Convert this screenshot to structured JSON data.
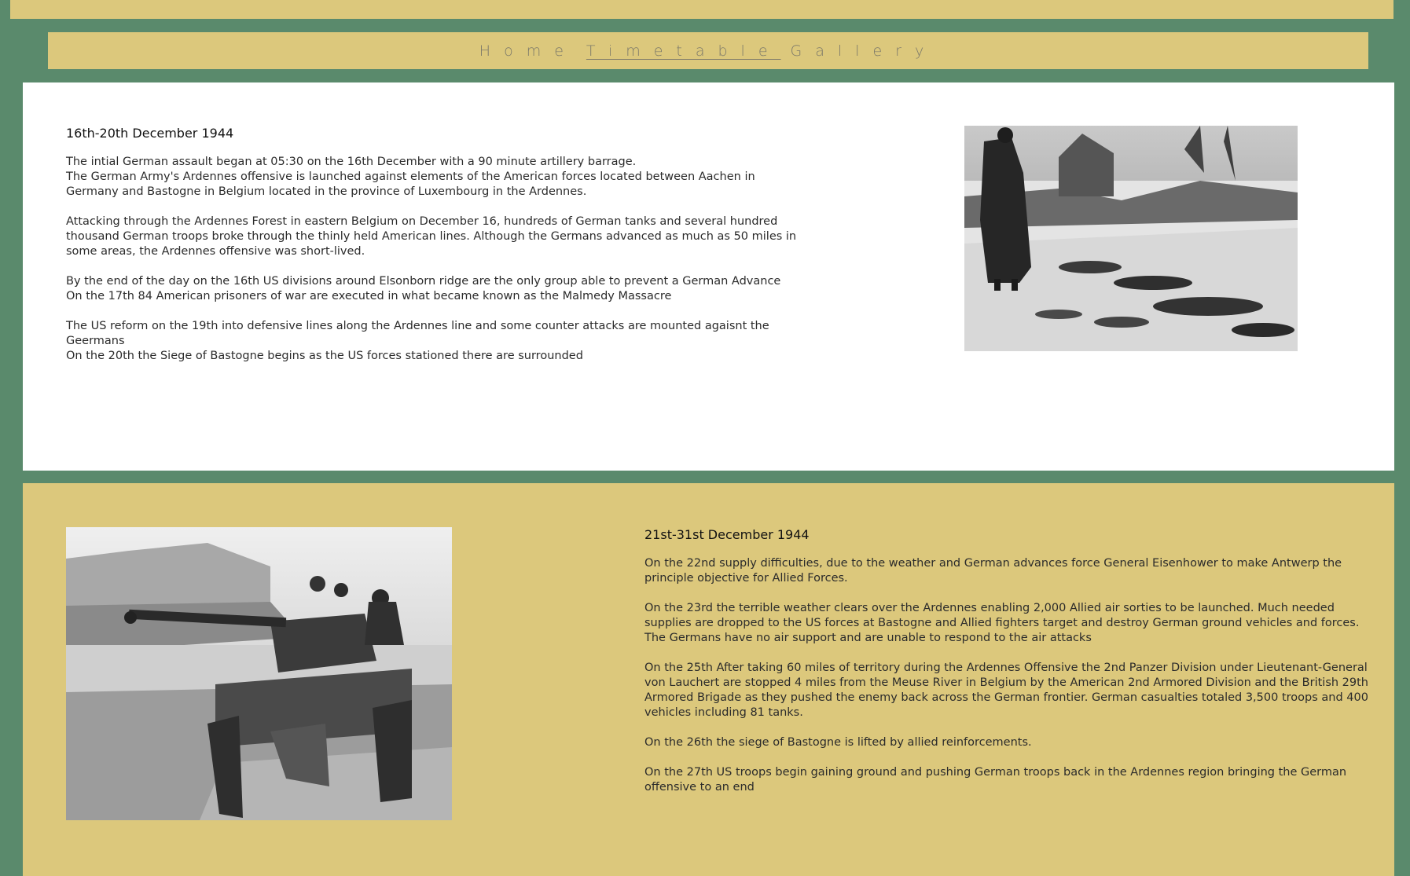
{
  "nav": {
    "items": [
      {
        "label": "Home",
        "active": false
      },
      {
        "label": "Timetable",
        "active": true
      },
      {
        "label": "Gallery",
        "active": false
      }
    ]
  },
  "section1": {
    "heading": "16th-20th December 1944",
    "paragraphs": [
      [
        "The intial German assault began at 05:30 on the 16th December with a 90 minute artillery barrage.",
        "The German Army's Ardennes offensive is launched against elements of the American forces located between Aachen in Germany and Bastogne in Belgium located in the province of Luxembourg in the Ardennes."
      ],
      [
        "Attacking through the Ardennes Forest in eastern Belgium on December 16, hundreds of German tanks and several hundred thousand German troops broke through the thinly held American lines. Although the Germans advanced as much as 50 miles in some areas, the Ardennes offensive was short-lived."
      ],
      [
        "By the end of the day on the 16th US divisions around Elsonborn ridge are the only group able to prevent a German Advance",
        "On the 17th 84 American prisoners of war are executed in what became known as the Malmedy Massacre"
      ],
      [
        "The US reform on the 19th into defensive lines along the Ardennes line and some counter attacks are mounted agaisnt the Geermans",
        "On the 20th the Siege of Bastogne begins as the US forces stationed there are surrounded"
      ]
    ]
  },
  "section2": {
    "heading": "21st-31st December 1944",
    "paragraphs": [
      [
        "On the 22nd supply difficulties, due to the weather and German advances force General Eisenhower to make Antwerp the principle objective for Allied Forces."
      ],
      [
        "On the 23rd the terrible weather clears over the Ardennes enabling 2,000 Allied air sorties to be launched. Much needed supplies are dropped to the US forces at Bastogne and Allied fighters target and destroy German ground vehicles and forces. The Germans have no air support and are unable to respond to the air attacks"
      ],
      [
        "On the 25th After taking 60 miles of territory during the Ardennes Offensive the 2nd Panzer Division under Lieutenant-General von Lauchert are stopped 4 miles from the Meuse River in Belgium by the American 2nd Armored Division and the British 29th Armored Brigade as they pushed the enemy back across the German frontier. German casualties totaled 3,500 troops and 400 vehicles including 81 tanks."
      ],
      [
        "On the 26th the siege of Bastogne is lifted by allied reinforcements."
      ],
      [
        "On the 27th US troops begin gaining ground and pushing German troops back in the Ardennes region bringing the German offensive to an end"
      ]
    ]
  },
  "colors": {
    "background": "#5a8a6c",
    "gold": "#dcc87c",
    "white": "#ffffff",
    "nav_text": "#7d7a6a"
  }
}
